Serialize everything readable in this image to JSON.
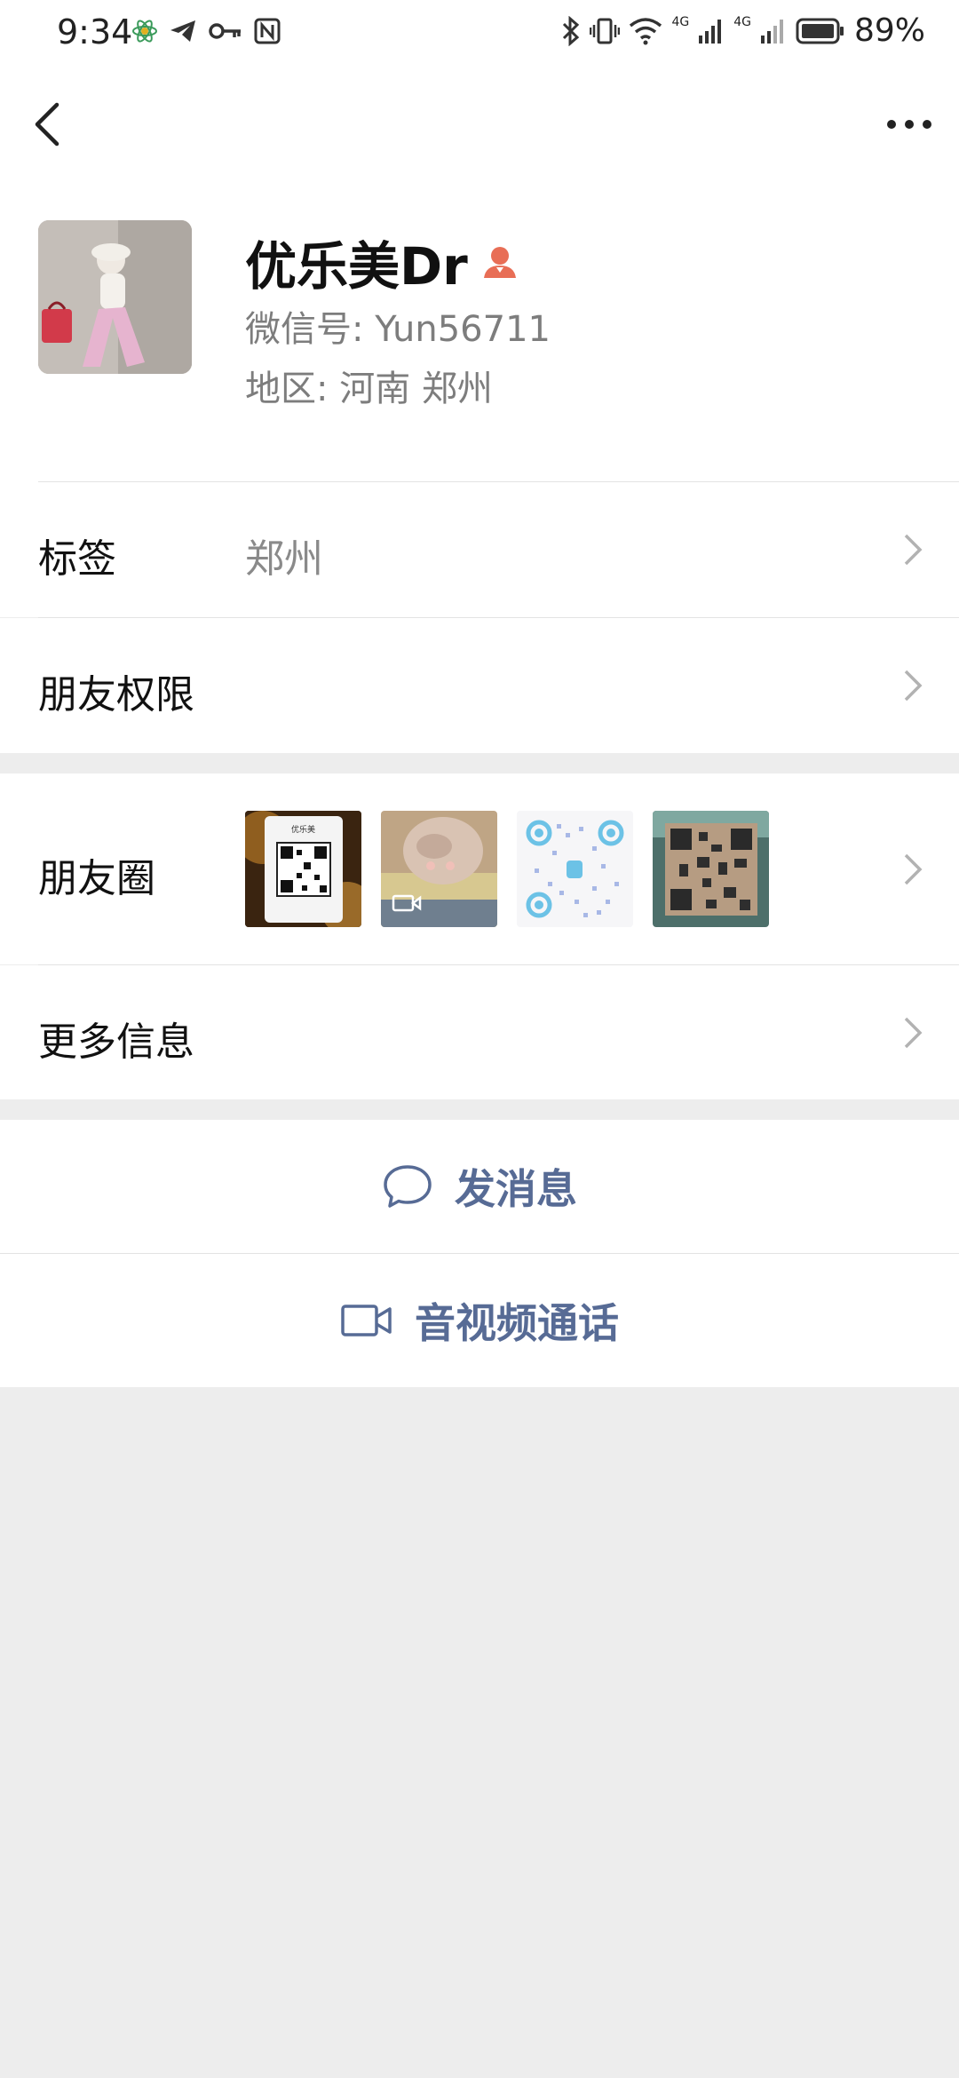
{
  "status_bar": {
    "time": "9:34",
    "network_1": "4G",
    "network_2": "4G",
    "battery": "89%"
  },
  "nav": {
    "back_icon": "chevron-left-icon",
    "more_icon": "more-dots-icon"
  },
  "profile": {
    "name": "优乐美Dr",
    "gender_icon": "female-icon",
    "wechat_id": "微信号: Yun56711",
    "region": "地区: 河南  郑州",
    "accent_color": "#e86e56"
  },
  "rows": {
    "tags_label": "标签",
    "tags_value": "郑州",
    "permissions_label": "朋友权限",
    "moments_label": "朋友圈",
    "more_info_label": "更多信息"
  },
  "moments_thumbs": {
    "thumb1_caption": "优乐美"
  },
  "actions": {
    "message_label": "发消息",
    "call_label": "音视频通话",
    "link_color": "#576b95"
  }
}
